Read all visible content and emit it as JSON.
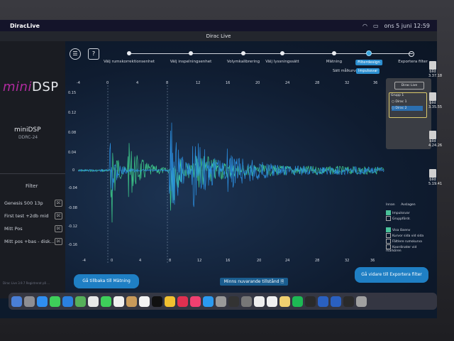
{
  "menubar": {
    "app_name": "DiracLive",
    "datetime": "ons 5 juni  12:59"
  },
  "window": {
    "title": "Dirac Live"
  },
  "sidebar": {
    "brand_prefix": "mini",
    "brand_suffix": "DSP",
    "device_name": "miniDSP",
    "device_model": "DDRC-24",
    "filter_title": "Filter",
    "filters": [
      {
        "label": "Genesis 500 13p",
        "badge": "DC"
      },
      {
        "label": "First test +2db mid",
        "badge": "DC"
      },
      {
        "label": "Mitt Pos",
        "badge": "DC"
      },
      {
        "label": "Mitt pos +bas - disk...",
        "badge": "DC"
      }
    ],
    "footer": "Dirac Live 3.9.7\nRegistrerat på ..."
  },
  "toolbar": {
    "menu_glyph": "☰",
    "help_glyph": "?"
  },
  "steps": [
    {
      "label": "Välj rumskorrektionsenhet"
    },
    {
      "label": "Välj inspelningsenhet"
    },
    {
      "label": "Volymkalibrering"
    },
    {
      "label": "Välj lyssningssätt"
    },
    {
      "label": "Mätning"
    },
    {
      "label": "Filterdesign"
    },
    {
      "label": "Exportera filter"
    }
  ],
  "subtabs": {
    "target": "Sätt målkurva",
    "impulse": "Impulssvar"
  },
  "plot": {
    "x_top": [
      "-4",
      "0",
      "4",
      "8",
      "12",
      "16",
      "20",
      "24",
      "28",
      "32",
      "36"
    ],
    "x_bottom": [
      "-4",
      "0",
      "4",
      "8",
      "12",
      "16",
      "20",
      "24",
      "28",
      "32",
      "36"
    ],
    "y": [
      "0.15",
      "0.12",
      "0.08",
      "0.04",
      "0",
      "-0.04",
      "-0.08",
      "-0.12",
      "-0.16"
    ]
  },
  "right_panel": {
    "header": "Dirac Live",
    "group_label": "Grupp 1",
    "items": [
      "Dirac 1",
      "Dirac 2"
    ]
  },
  "legend_panel": {
    "col_before": "Innan",
    "col_after": "Avslagen",
    "rows": [
      "Impulssvar",
      "Gruppfördr."
    ],
    "options": [
      "Visa läsenv",
      "Kurvor sida vid sida",
      "Fältlere rumskurva",
      "Koordinater vid markören"
    ]
  },
  "buttons": {
    "back": "Gå tillbaka till Mätning",
    "save": "Minns nuvarande tillstånd",
    "save_icon": "🗎",
    "next": "Gå vidare till Exportera filter"
  },
  "desktop": {
    "items": [
      {
        "label": "bild",
        "sub": "3.37.18"
      },
      {
        "label": "bild",
        "sub": "3.35.55"
      },
      {
        "label": "bild",
        "sub": "4.24.26"
      },
      {
        "label": "bild",
        "sub": "5.19.41"
      }
    ]
  },
  "colors": {
    "before_trace": "#3ecf8e",
    "after_trace": "#2b8fe0",
    "accent": "#1f7fc4",
    "brand": "#b12ba0"
  }
}
